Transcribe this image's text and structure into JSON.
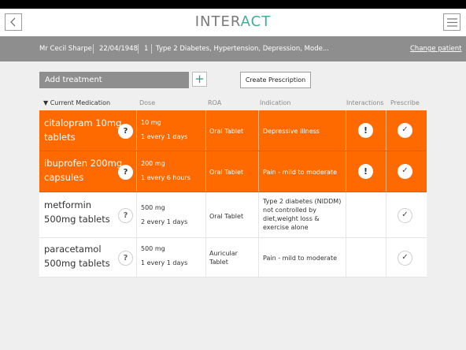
{
  "app": {
    "logo_part1": "INTER",
    "logo_part2": "ACT"
  },
  "patient": {
    "name": "Mr Cecil Sharpe",
    "dob": "22/04/1948",
    "number": "1",
    "conditions": "Type 2 Diabetes, Hypertension, Depression, Mode...",
    "change_label": "Change patient"
  },
  "toolbar": {
    "add_treatment_label": "Add treatment",
    "plus_label": "+",
    "create_prescription_label": "Create Prescription"
  },
  "columns": {
    "current_medication": "▼ Current Medication",
    "dose": "Dose",
    "roa": "ROA",
    "indication": "Indication",
    "interactions": "Interactions",
    "prescribe": "Prescribe"
  },
  "medications": [
    {
      "name": "citalopram 10mg tablets",
      "dose": "10 mg",
      "frequency": "1 every 1 days",
      "roa": "Oral Tablet",
      "indication": "Depressive illness",
      "has_interaction": true,
      "highlighted": true
    },
    {
      "name": "ibuprofen 200mg capsules",
      "dose": "200 mg",
      "frequency": "1 every 6 hours",
      "roa": "Oral Tablet",
      "indication": "Pain - mild to moderate",
      "has_interaction": true,
      "highlighted": true
    },
    {
      "name": "metformin 500mg tablets",
      "dose": "500 mg",
      "frequency": "2 every 1 days",
      "roa": "Oral Tablet",
      "indication": "Type 2 diabetes (NIDDM) not controlled by diet,weight loss & exercise alone",
      "has_interaction": false,
      "highlighted": false
    },
    {
      "name": "paracetamol 500mg tablets",
      "dose": "500 mg",
      "frequency": "1 every 1 days",
      "roa": "Auricular Tablet",
      "indication": "Pain - mild to moderate",
      "has_interaction": false,
      "highlighted": false
    }
  ],
  "icons": {
    "info": "?",
    "alert": "!",
    "check": "✓"
  },
  "colors": {
    "highlight": "#ff6a00",
    "accent": "#3fae9a",
    "bar": "#8e8e8e"
  }
}
